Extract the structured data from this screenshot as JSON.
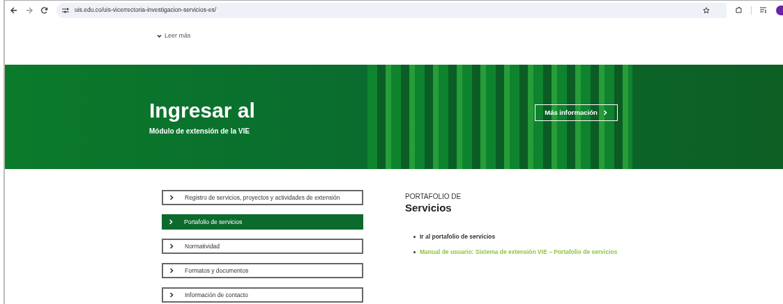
{
  "browser": {
    "url": "uis.edu.co/uis-vicerrectoria-investigacion-servicios-es/"
  },
  "read_more": {
    "label": "Leer más"
  },
  "banner": {
    "title": "Ingresar al",
    "subtitle": "Módulo de extensión de la VIE",
    "button": "Más información"
  },
  "menu": [
    {
      "label": "Registro de servicios, proyectos y actividades de extensión",
      "selected": false
    },
    {
      "label": "Portafolio de servicios",
      "selected": true
    },
    {
      "label": "Normatividad",
      "selected": false
    },
    {
      "label": "Formatos y documentos",
      "selected": false
    },
    {
      "label": "Información de contacto",
      "selected": false
    }
  ],
  "section": {
    "kicker": "PORTAFOLIO DE",
    "title": "Servicios",
    "links": [
      {
        "label": "Ir al portafolio de servicios",
        "color": "#333333"
      },
      {
        "label": "Manual de usuario: Sistema de extensión VIE – Portafolio de servicios",
        "color": "#8cc63f"
      }
    ]
  }
}
